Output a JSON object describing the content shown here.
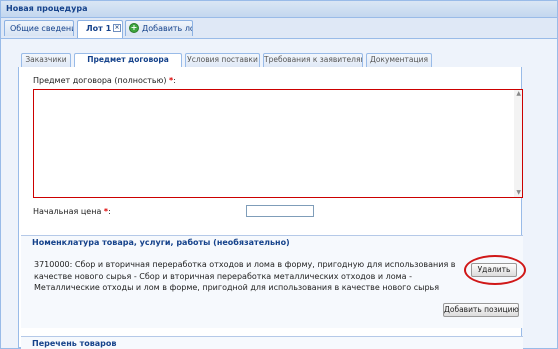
{
  "window": {
    "title": "Новая процедура"
  },
  "outer_tabs": [
    {
      "label": "Общие сведения",
      "active": false
    },
    {
      "label": "Лот 1",
      "active": true,
      "closable": true
    },
    {
      "label": "Добавить лот",
      "icon": "add-icon"
    }
  ],
  "inner_tabs": [
    {
      "label": "Заказчики",
      "active": false
    },
    {
      "label": "Предмет договора",
      "active": true
    },
    {
      "label": "Условия поставки",
      "active": false
    },
    {
      "label": "Требования к заявителям",
      "active": false
    },
    {
      "label": "Документация",
      "active": false
    }
  ],
  "form": {
    "subject_label": "Предмет договора (полностью)",
    "subject_value": "",
    "price_label": "Начальная цена",
    "price_value": "",
    "required_mark": "*"
  },
  "nomenclature": {
    "legend": "Номенклатура товара, услуги, работы (необязательно)",
    "item_text": "3710000: Сбор и вторичная переработка отходов и лома в форму, пригодную для использования в качестве нового сырья - Сбор и вторичная переработка металлических отходов и лома - Металлические отходы и лом в форме, пригодной для использования в качестве нового сырья",
    "delete_button": "Удалить",
    "add_button": "Добавить позицию"
  },
  "goods_list": {
    "legend": "Перечень товаров"
  },
  "colors": {
    "accent": "#15428b",
    "border": "#99bbe8",
    "required": "#dd0000",
    "highlight": "#d01818"
  }
}
